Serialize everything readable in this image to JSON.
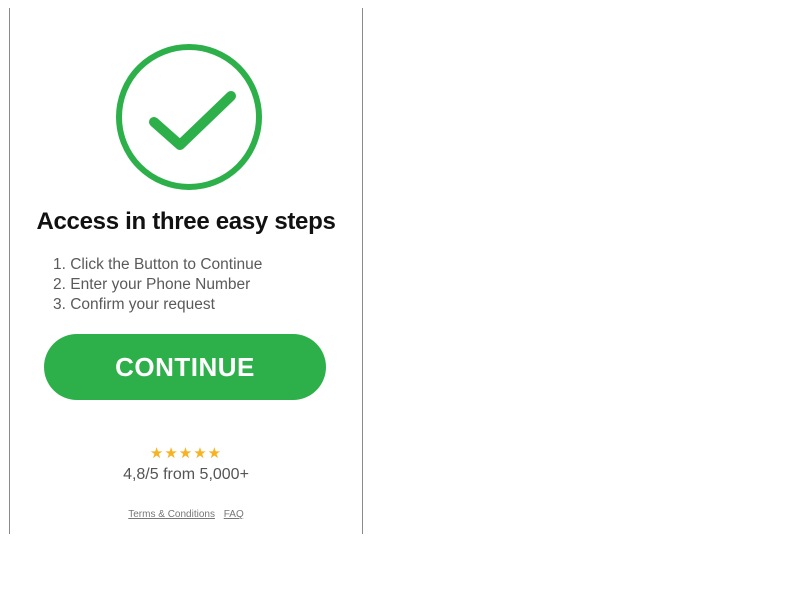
{
  "hero": {
    "icon": "check-circle-icon",
    "color": "#2db04a"
  },
  "heading": "Access in three easy steps",
  "steps": [
    "1. Click the Button to Continue",
    "2. Enter your Phone Number",
    "3. Confirm your request"
  ],
  "cta": {
    "label": "CONTINUE",
    "color": "#2db04a"
  },
  "rating": {
    "stars": "★★★★★",
    "star_count": 5,
    "star_color": "#f6b322",
    "text": "4,8/5 from 5,000+"
  },
  "footer": {
    "terms_label": "Terms & Conditions",
    "faq_label": "FAQ"
  }
}
